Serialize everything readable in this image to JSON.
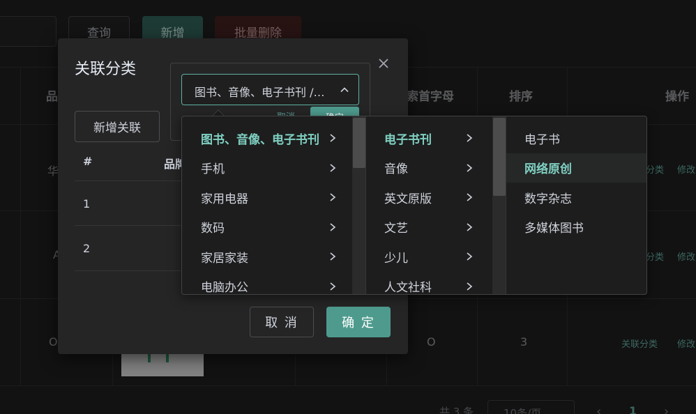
{
  "toolbar": {
    "query_label": "查询",
    "add_label": "新增",
    "batch_delete_label": "批量删除"
  },
  "table": {
    "headers": {
      "name_partial": "品",
      "initial_letter_partial": "检索首字母",
      "sort": "排序",
      "action": "操作"
    },
    "rows": [
      {
        "name_partial": "华",
        "action_relate": "分类",
        "action_edit": "修改"
      },
      {
        "name_partial": "A",
        "action_relate": "分类",
        "action_edit": "修改"
      },
      {
        "name_partial": "O",
        "initial_letter": "O",
        "sort": "3",
        "action_relate": "关联分类",
        "action_edit": "修改"
      }
    ]
  },
  "pagination": {
    "total_partial": "共 3 条",
    "page_size": "10条/页",
    "prev": "‹",
    "current": "1",
    "next": "›"
  },
  "dialog": {
    "title": "关联分类",
    "new_relation_label": "新增关联",
    "table_headers": {
      "num": "#",
      "name_partial": "品牌"
    },
    "rows": [
      "1",
      "2"
    ],
    "cancel_label": "取 消",
    "ok_label": "确 定"
  },
  "popover": {
    "cancel_label": "取消",
    "ok_label": "确定"
  },
  "cascader": {
    "input_value": "图书、音像、电子书刊 /…",
    "menu1": [
      "图书、音像、电子书刊",
      "手机",
      "家用电器",
      "数码",
      "家居家装",
      "电脑办公"
    ],
    "menu1_active": 0,
    "menu2": [
      "电子书刊",
      "音像",
      "英文原版",
      "文艺",
      "少儿",
      "人文社科"
    ],
    "menu2_active": 0,
    "menu3": [
      "电子书",
      "网络原创",
      "数字杂志",
      "多媒体图书"
    ],
    "menu3_active": 1,
    "accent_color": "#7fd0c2"
  },
  "colors": {
    "primary": "#4e9b8e",
    "danger_bg": "#3e1e1e",
    "background": "#1d1d1d"
  }
}
